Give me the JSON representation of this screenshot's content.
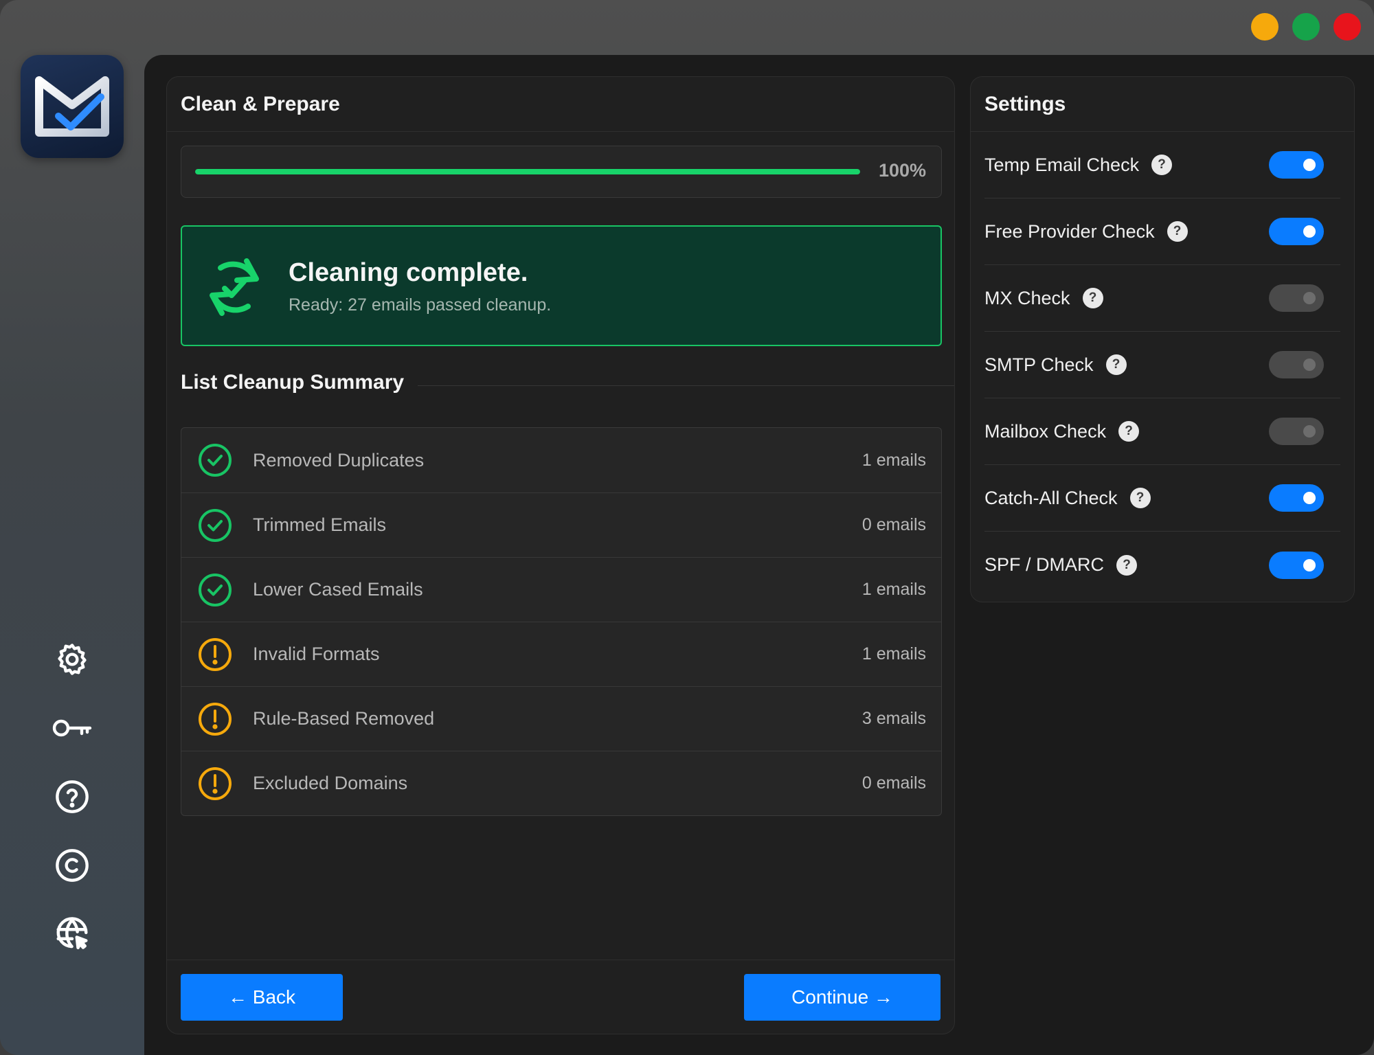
{
  "window": {
    "controls": [
      {
        "name": "minimize-button",
        "color": "#f6a90c"
      },
      {
        "name": "maximize-button",
        "color": "#16a34a"
      },
      {
        "name": "close-button",
        "color": "#e8141c"
      }
    ]
  },
  "sidebar": {
    "logo_icon": "mail-check-logo-icon",
    "items": [
      {
        "name": "settings",
        "icon": "gear-icon"
      },
      {
        "name": "license",
        "icon": "key-icon"
      },
      {
        "name": "help",
        "icon": "question-circle-icon"
      },
      {
        "name": "copyright",
        "icon": "copyright-icon"
      },
      {
        "name": "website",
        "icon": "globe-cursor-icon"
      }
    ]
  },
  "main": {
    "title": "Clean & Prepare",
    "progress": {
      "value": 100,
      "label": "100%",
      "color": "#18d36a"
    },
    "status": {
      "title": "Cleaning complete.",
      "subtitle": "Ready: 27 emails passed cleanup.",
      "icon": "refresh-check-icon"
    },
    "summary_title": "List Cleanup Summary",
    "summary": [
      {
        "label": "Removed Duplicates",
        "count": "1 emails",
        "status": "ok"
      },
      {
        "label": "Trimmed Emails",
        "count": "0 emails",
        "status": "ok"
      },
      {
        "label": "Lower Cased Emails",
        "count": "1 emails",
        "status": "ok"
      },
      {
        "label": "Invalid Formats",
        "count": "1 emails",
        "status": "warn"
      },
      {
        "label": "Rule-Based Removed",
        "count": "3 emails",
        "status": "warn"
      },
      {
        "label": "Excluded Domains",
        "count": "0 emails",
        "status": "warn"
      }
    ],
    "back_label": "← Back",
    "continue_label": "Continue →"
  },
  "settings": {
    "title": "Settings",
    "items": [
      {
        "label": "Temp Email Check",
        "enabled": true
      },
      {
        "label": "Free Provider Check",
        "enabled": true
      },
      {
        "label": "MX Check",
        "enabled": false
      },
      {
        "label": "SMTP Check",
        "enabled": false
      },
      {
        "label": "Mailbox Check",
        "enabled": false
      },
      {
        "label": "Catch-All Check",
        "enabled": true
      },
      {
        "label": "SPF / DMARC",
        "enabled": true
      }
    ],
    "help_glyph": "?"
  },
  "colors": {
    "accent": "#0a7cff",
    "success": "#18c464",
    "warning": "#f6a90c"
  }
}
